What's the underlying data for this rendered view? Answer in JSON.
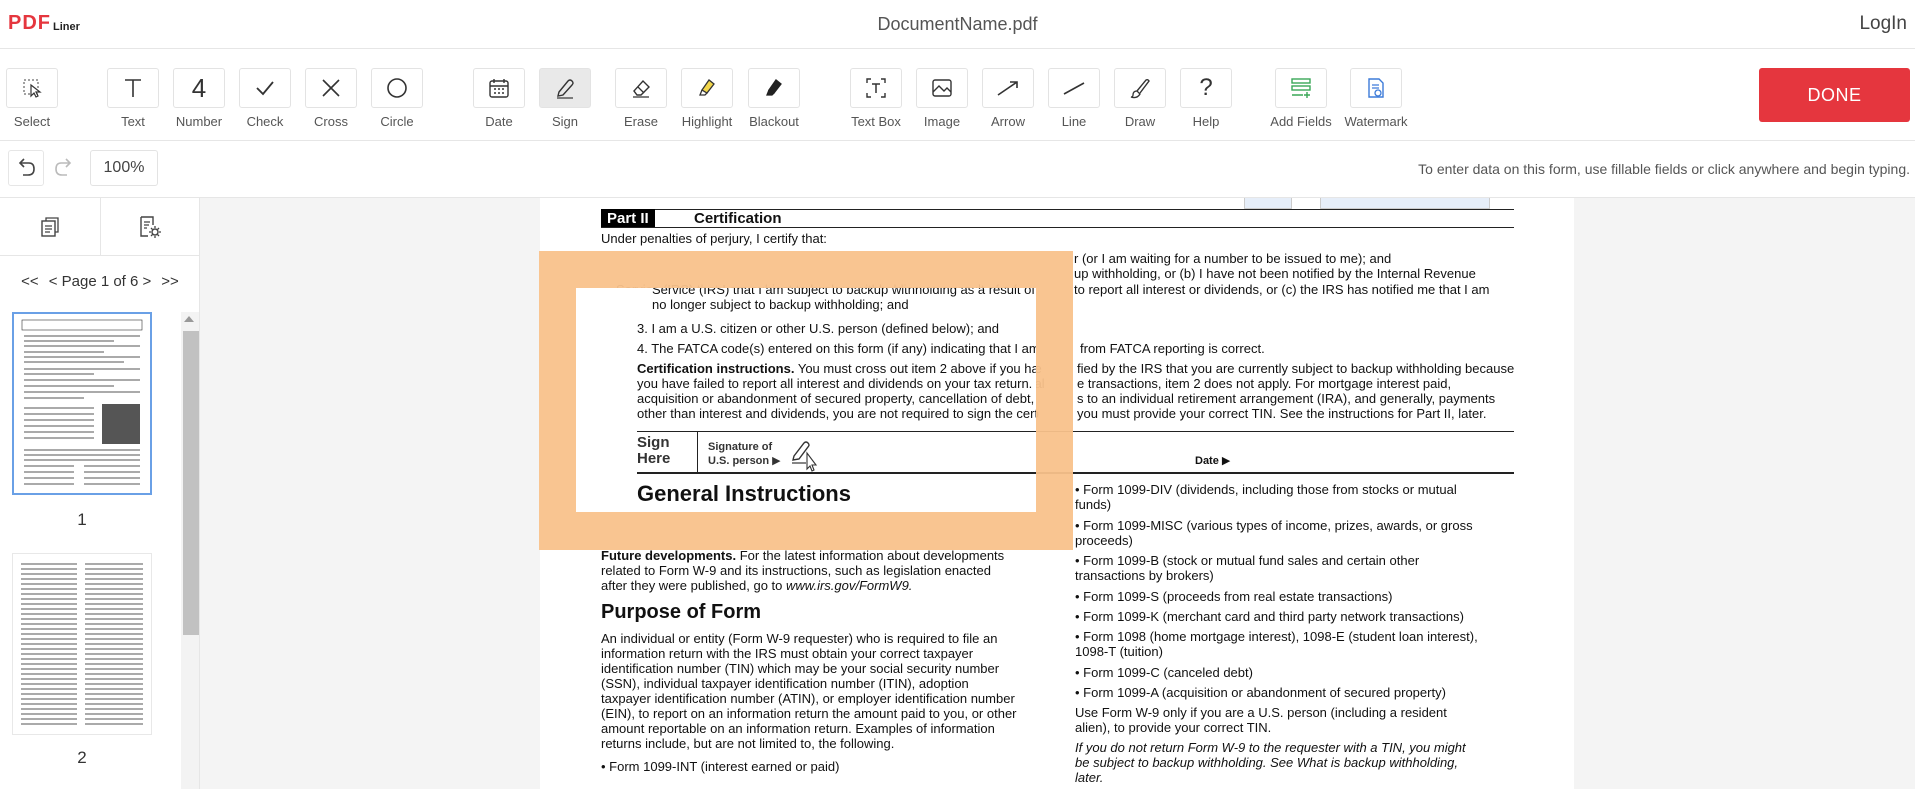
{
  "header": {
    "logo_pdf": "PDF",
    "logo_liner": "Liner",
    "document_name": "DocumentName.pdf",
    "login_label": "LogIn"
  },
  "toolbar": {
    "tools": [
      {
        "id": "select",
        "label": "Select",
        "icon": "select-cursor-icon"
      },
      {
        "id": "text",
        "label": "Text",
        "icon": "text-icon"
      },
      {
        "id": "number",
        "label": "Number",
        "icon": "number-icon"
      },
      {
        "id": "check",
        "label": "Check",
        "icon": "check-icon"
      },
      {
        "id": "cross",
        "label": "Cross",
        "icon": "cross-icon"
      },
      {
        "id": "circle",
        "label": "Circle",
        "icon": "circle-icon"
      },
      {
        "id": "date",
        "label": "Date",
        "icon": "calendar-icon"
      },
      {
        "id": "sign",
        "label": "Sign",
        "icon": "pen-icon"
      },
      {
        "id": "erase",
        "label": "Erase",
        "icon": "eraser-icon"
      },
      {
        "id": "highlight",
        "label": "Highlight",
        "icon": "highlighter-icon"
      },
      {
        "id": "blackout",
        "label": "Blackout",
        "icon": "blackout-icon"
      },
      {
        "id": "textbox",
        "label": "Text Box",
        "icon": "textbox-icon"
      },
      {
        "id": "image",
        "label": "Image",
        "icon": "image-icon"
      },
      {
        "id": "arrow",
        "label": "Arrow",
        "icon": "arrow-icon"
      },
      {
        "id": "line",
        "label": "Line",
        "icon": "line-icon"
      },
      {
        "id": "draw",
        "label": "Draw",
        "icon": "brush-icon"
      },
      {
        "id": "help",
        "label": "Help",
        "icon": "question-icon"
      },
      {
        "id": "addfields",
        "label": "Add Fields",
        "icon": "add-fields-icon"
      },
      {
        "id": "watermark",
        "label": "Watermark",
        "icon": "watermark-icon"
      }
    ],
    "number_glyph": "4",
    "help_glyph": "?",
    "done_label": "DONE",
    "active_tool": "sign"
  },
  "secondary": {
    "zoom": "100%",
    "hint": "To enter data on this form, use fillable fields or click anywhere and begin typing."
  },
  "sidebar": {
    "page_nav_first": "<<",
    "page_nav_prev": "<",
    "page_indicator": "Page 1 of 6",
    "page_nav_next": ">",
    "page_nav_last": ">>",
    "thumbnails": [
      {
        "page": "1",
        "selected": true
      },
      {
        "page": "2",
        "selected": false
      }
    ]
  },
  "document": {
    "part_label": "Part II",
    "part_title": "Certification",
    "lines": [
      "Under penalties of perjury, I certify that:",
      "r (or I am waiting for a number to be issued to me); and",
      "up withholding, or (b) I have not been notified by the Internal Revenue",
      "Service (IRS) that I am subject to backup withholding as a result of a f",
      "to report all interest or dividends, or (c) the IRS has notified me that I am",
      "no longer subject to backup withholding; and",
      "3. I am a U.S. citizen or other U.S. person (defined below); and",
      "4. The FATCA code(s) entered on this form (if any) indicating that I am ex",
      "from FATCA reporting is correct.",
      "Certification instructions.",
      " You must cross out item 2 above if you have bee",
      "fied by the IRS that you are currently subject to backup withholding because",
      "you have failed to report all interest and dividends on your tax return. For real",
      "e transactions, item 2 does not apply. For mortgage interest paid,",
      "acquisition or abandonment of secured property, cancellation of debt, contr",
      "s to an individual retirement arrangement (IRA), and generally, payments",
      "other than interest and dividends, you are not required to sign the certificatio",
      "you must provide your correct TIN. See the instructions for Part II, later."
    ],
    "sign_here": [
      "Sign",
      "Here"
    ],
    "sig_label": [
      "Signature of",
      "U.S. person ▶"
    ],
    "date_label": "Date ▶",
    "general_instructions": "General Instructions",
    "future_dev_bold": "Future developments.",
    "future_dev": [
      " For the latest information about developments",
      "related to Form W-9 and its instructions, such as legislation enacted",
      "after they were published, go to "
    ],
    "future_dev_link": "www.irs.gov/FormW9.",
    "purpose_title": "Purpose of Form",
    "purpose_lines": [
      "An individual or entity (Form W-9 requester) who is required to file an",
      "information return with the IRS must obtain your correct taxpayer",
      "identification number (TIN) which may be your social security number",
      "(SSN), individual taxpayer identification number (ITIN), adoption",
      "taxpayer identification number (ATIN), or employer identification number",
      "(EIN), to report on an information return the amount paid to you, or other",
      "amount reportable on an information return. Examples of information",
      "returns include, but are not limited to, the following.",
      "• Form 1099-INT (interest earned or paid)"
    ],
    "right_lines": [
      "• Form 1099-DIV (dividends, including those from stocks or mutual",
      "funds)",
      "• Form 1099-MISC (various types of income, prizes, awards, or gross",
      "proceeds)",
      "• Form 1099-B (stock or mutual fund sales and certain other",
      "transactions by brokers)",
      "• Form 1099-S (proceeds from real estate transactions)",
      "• Form 1099-K (merchant card and third party network transactions)",
      "• Form 1098 (home mortgage interest), 1098-E (student loan interest),",
      "1098-T (tuition)",
      "• Form 1099-C (canceled debt)",
      "• Form 1099-A (acquisition or abandonment of secured property)",
      "   Use Form W-9 only if you are a U.S. person (including a resident",
      "alien), to provide your correct TIN.",
      "   If you do not return Form W-9 to the requester with a TIN, you might",
      "be subject to backup withholding. See What is backup withholding,",
      "later."
    ]
  },
  "colors": {
    "brand_red": "#e5363e",
    "overlay": "#f9c28b",
    "thumb_selected": "#6aa0e6"
  }
}
